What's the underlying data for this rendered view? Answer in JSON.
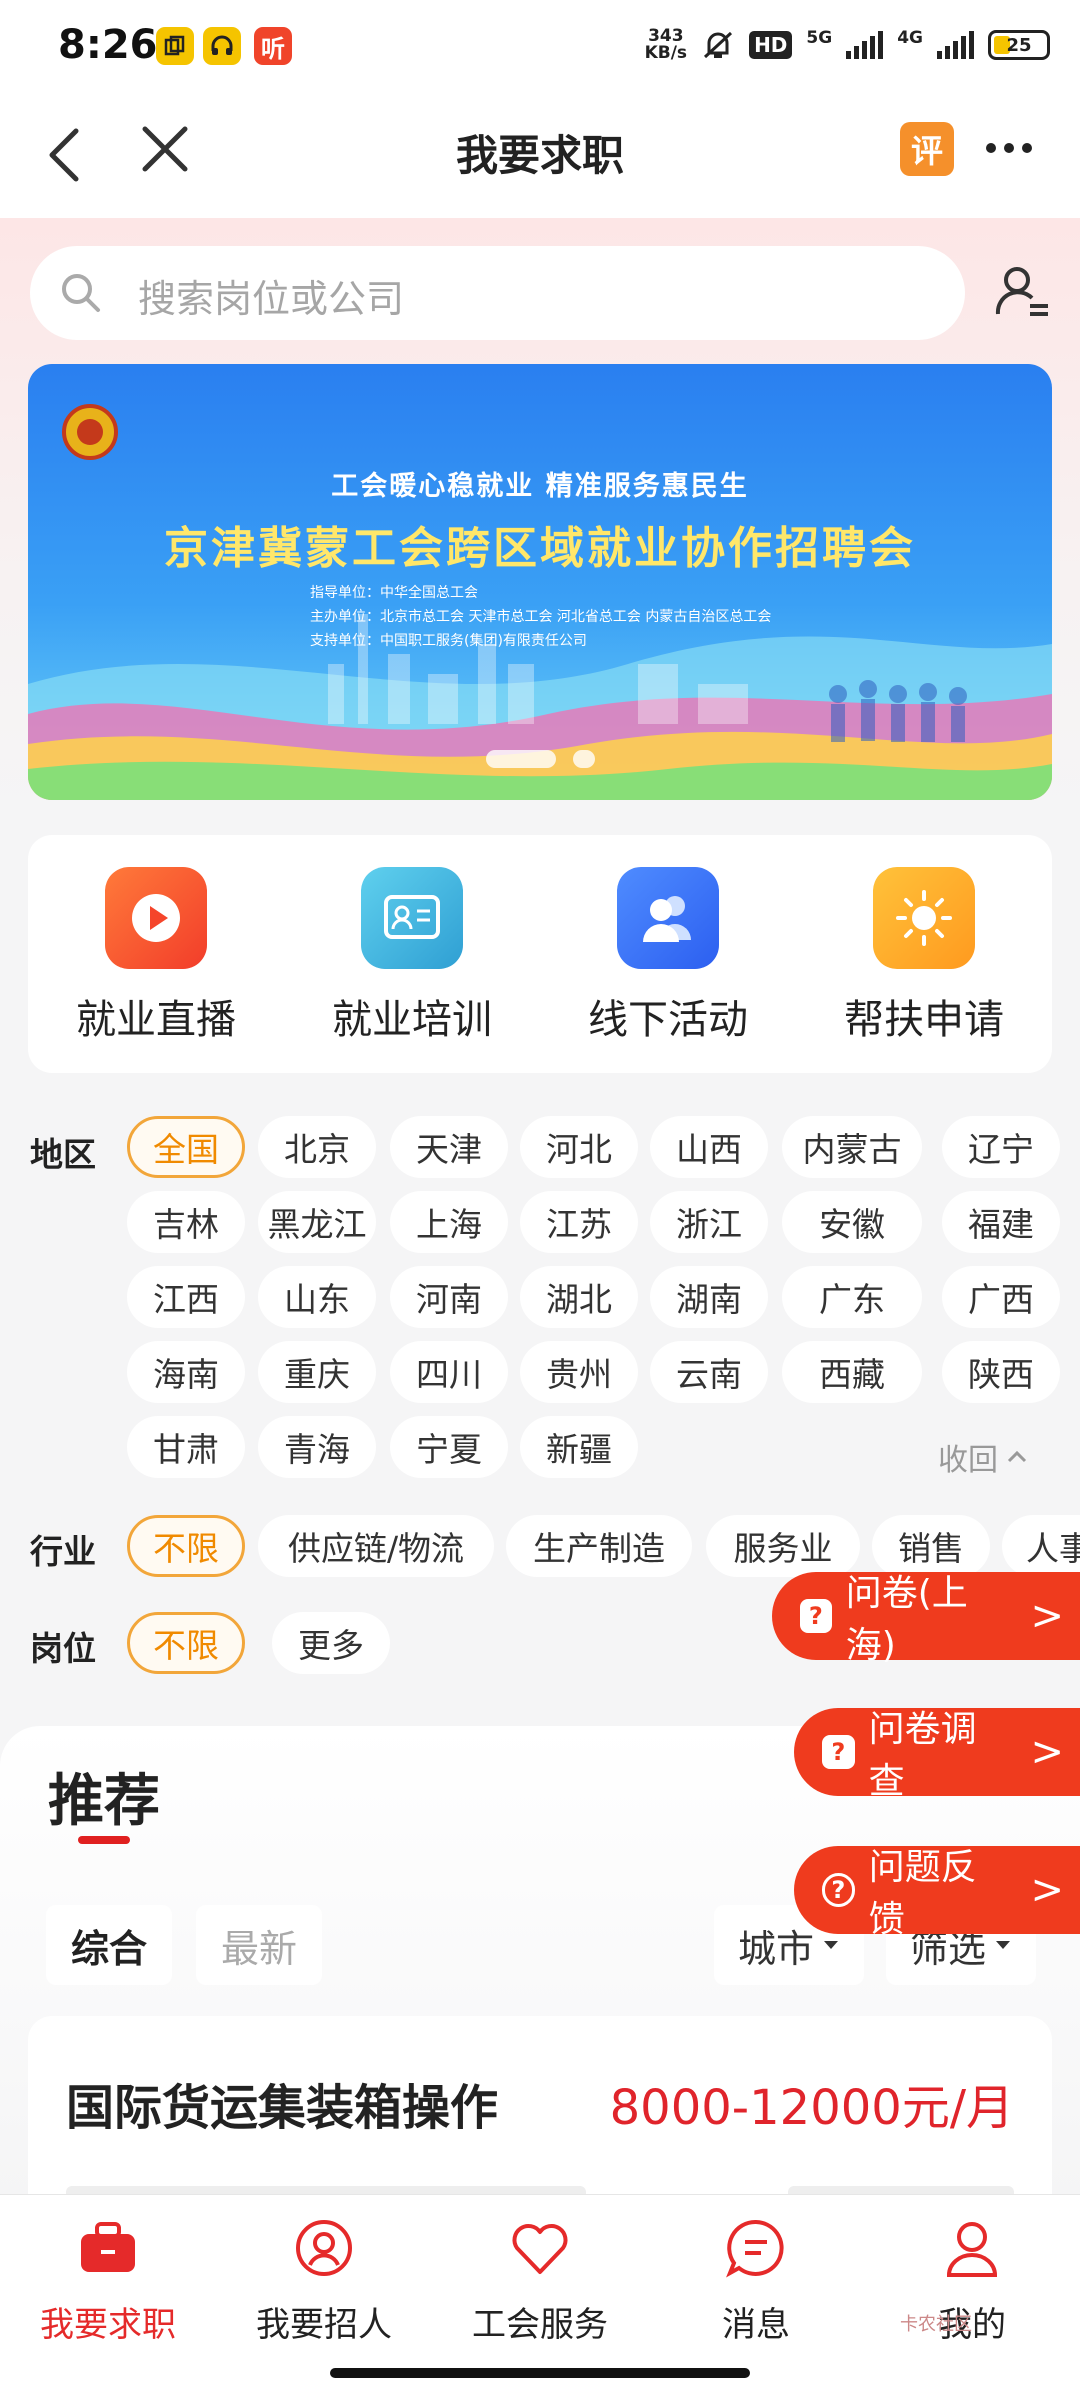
{
  "status_bar": {
    "time": "8:26",
    "apps": [
      "copy-app-icon",
      "headphones-app-icon",
      "ting-app-icon"
    ],
    "app_ting_label": "听",
    "net_speed_top": "343",
    "net_speed_bottom": "KB/s",
    "hd_label": "HD",
    "sig1_label": "5G",
    "sig2_label": "4G",
    "battery": "25"
  },
  "nav": {
    "title": "我要求职",
    "review_label": "评"
  },
  "search": {
    "placeholder": "搜索岗位或公司"
  },
  "banner": {
    "subtitle": "工会暖心稳就业   精准服务惠民生",
    "title": "京津冀蒙工会跨区域就业协作招聘会",
    "line1": "指导单位：中华全国总工会",
    "line2": "主办单位：北京市总工会    天津市总工会    河北省总工会    内蒙古自治区总工会",
    "line3": "支持单位：中国职工服务(集团)有限责任公司"
  },
  "quick_actions": [
    {
      "label": "就业直播",
      "color": "#ff5a2b"
    },
    {
      "label": "就业培训",
      "color": "#3bb3dc"
    },
    {
      "label": "线下活动",
      "color": "#3b7cf5"
    },
    {
      "label": "帮扶申请",
      "color": "#ffab2b"
    }
  ],
  "filters": {
    "region_label": "地区",
    "regions": [
      "全国",
      "北京",
      "天津",
      "河北",
      "山西",
      "内蒙古",
      "辽宁",
      "吉林",
      "黑龙江",
      "上海",
      "江苏",
      "浙江",
      "安徽",
      "福建",
      "江西",
      "山东",
      "河南",
      "湖北",
      "湖南",
      "广东",
      "广西",
      "海南",
      "重庆",
      "四川",
      "贵州",
      "云南",
      "西藏",
      "陕西",
      "甘肃",
      "青海",
      "宁夏",
      "新疆"
    ],
    "collapse_label": "收回",
    "industry_label": "行业",
    "industries": [
      "不限",
      "供应链/物流",
      "生产制造",
      "服务业",
      "销售",
      "人事"
    ],
    "position_label": "岗位",
    "positions": [
      "不限",
      "更多"
    ]
  },
  "floating": {
    "survey_sh": "问卷(上海)",
    "survey": "问卷调查",
    "feedback": "问题反馈"
  },
  "recommend": {
    "title": "推荐",
    "tab_all": "综合",
    "tab_latest": "最新",
    "city_label": "城市",
    "filter_label": "筛选"
  },
  "job": {
    "title": "国际货运集装箱操作",
    "salary": "8000-12000元/月"
  },
  "tabbar": [
    {
      "label": "我要求职",
      "active": true
    },
    {
      "label": "我要招人",
      "active": false
    },
    {
      "label": "工会服务",
      "active": false
    },
    {
      "label": "消息",
      "active": false
    },
    {
      "label": "我的",
      "active": false
    }
  ],
  "watermark": "卡农社区"
}
